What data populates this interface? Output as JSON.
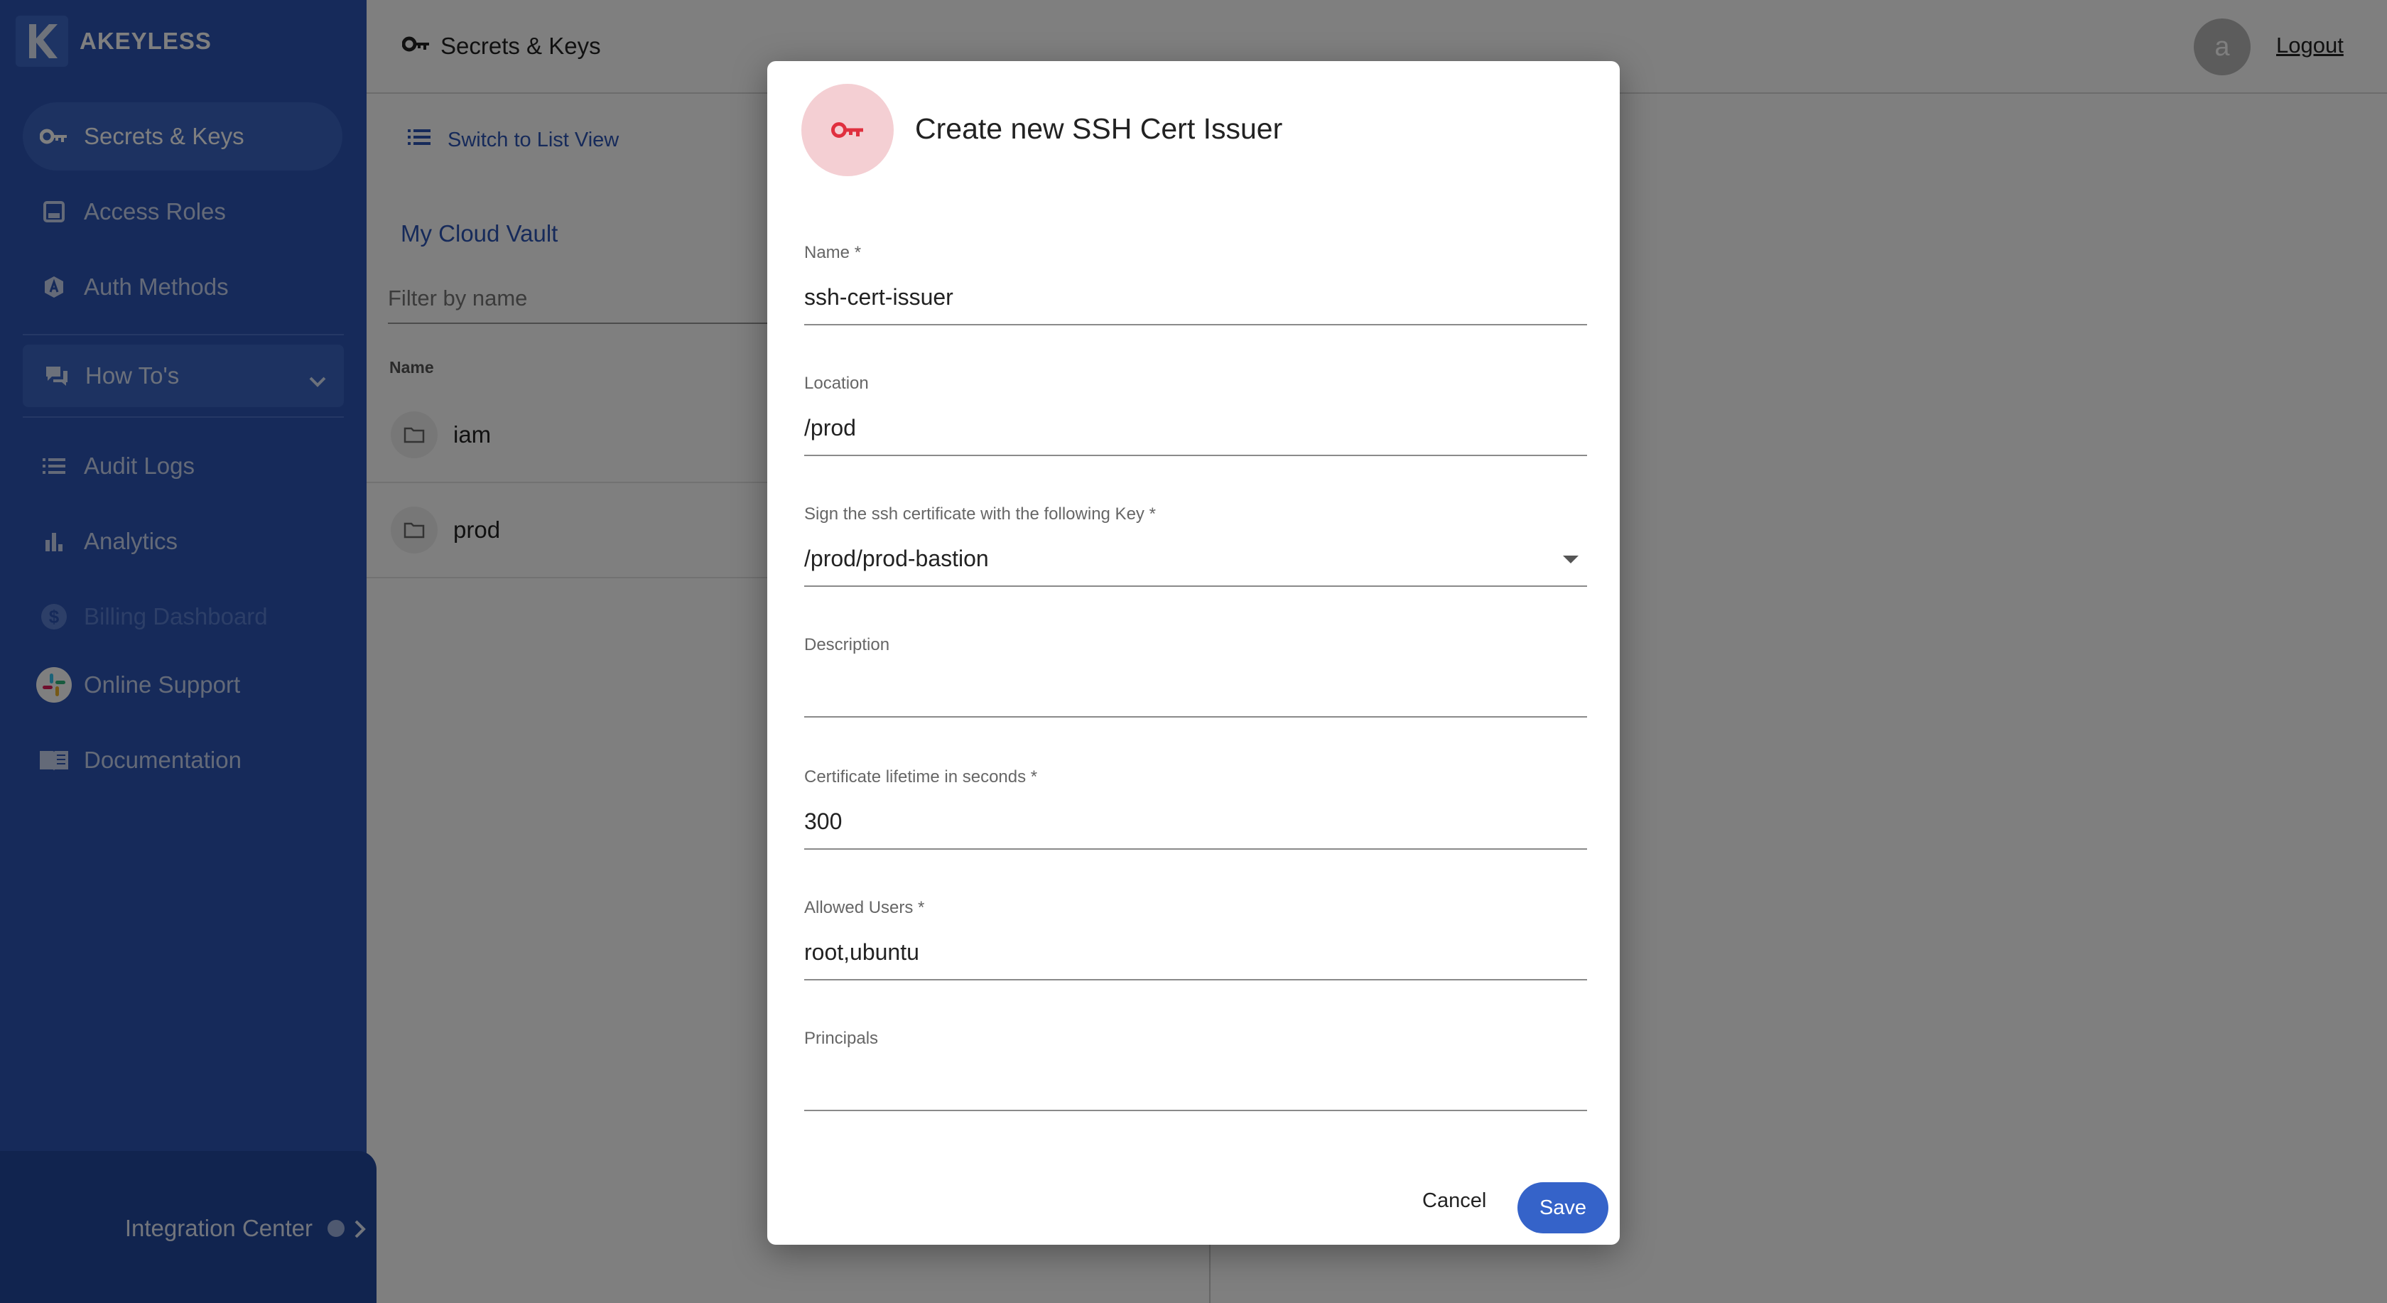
{
  "brand": {
    "name": "AKEYLESS"
  },
  "sidebar": {
    "items": [
      {
        "label": "Secrets & Keys",
        "icon": "key-icon"
      },
      {
        "label": "Access Roles",
        "icon": "roles-icon"
      },
      {
        "label": "Auth Methods",
        "icon": "auth-methods-icon"
      },
      {
        "label": "How To's",
        "icon": "chat-icon"
      },
      {
        "label": "Audit Logs",
        "icon": "list-icon"
      },
      {
        "label": "Analytics",
        "icon": "bar-chart-icon"
      },
      {
        "label": "Billing Dashboard",
        "icon": "dollar-icon"
      },
      {
        "label": "Online Support",
        "icon": "slack-icon"
      },
      {
        "label": "Documentation",
        "icon": "book-icon"
      }
    ],
    "integration_center": "Integration Center"
  },
  "topbar": {
    "title": "Secrets & Keys",
    "avatar_letter": "a",
    "logout": "Logout"
  },
  "main": {
    "switch_view": "Switch to List View",
    "vault_tab": "My Cloud Vault",
    "filter_placeholder": "Filter by name",
    "column_name": "Name",
    "rows": [
      {
        "name": "iam"
      },
      {
        "name": "prod"
      }
    ]
  },
  "dialog": {
    "title": "Create new SSH Cert Issuer",
    "fields": [
      {
        "label": "Name *",
        "value": "ssh-cert-issuer"
      },
      {
        "label": "Location",
        "value": "/prod"
      },
      {
        "label": "Sign the ssh certificate with the following Key *",
        "value": "/prod/prod-bastion"
      },
      {
        "label": "Description",
        "value": ""
      },
      {
        "label": "Certificate lifetime in seconds *",
        "value": "300"
      },
      {
        "label": "Allowed Users *",
        "value": "root,ubuntu"
      },
      {
        "label": "Principals",
        "value": ""
      }
    ],
    "cancel": "Cancel",
    "save": "Save"
  },
  "colors": {
    "sidebar": "#2c55b5",
    "accent": "#3563c9",
    "key_icon": "#e0303f"
  }
}
